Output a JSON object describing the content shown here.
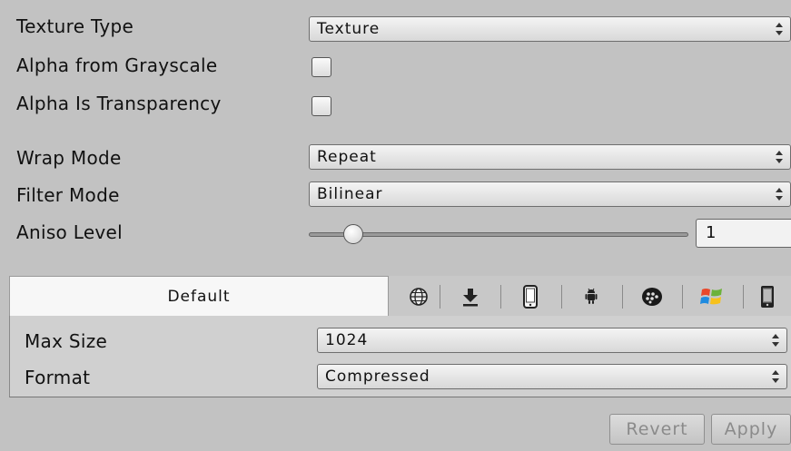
{
  "fields": {
    "texture_type": {
      "label": "Texture Type",
      "value": "Texture"
    },
    "alpha_from_grayscale": {
      "label": "Alpha from Grayscale",
      "checked": false
    },
    "alpha_is_transparency": {
      "label": "Alpha Is Transparency",
      "checked": false
    },
    "wrap_mode": {
      "label": "Wrap Mode",
      "value": "Repeat"
    },
    "filter_mode": {
      "label": "Filter Mode",
      "value": "Bilinear"
    },
    "aniso_level": {
      "label": "Aniso Level",
      "value": "1",
      "slider_fraction": 0.1
    }
  },
  "platform_tabs": {
    "default_label": "Default",
    "icons": [
      "globe-icon",
      "download-icon",
      "iphone-icon",
      "android-icon",
      "blackberry-icon",
      "windows-icon",
      "windows-phone-icon"
    ]
  },
  "platform_settings": {
    "max_size": {
      "label": "Max Size",
      "value": "1024"
    },
    "format": {
      "label": "Format",
      "value": "Compressed"
    }
  },
  "buttons": {
    "revert": "Revert",
    "apply": "Apply"
  }
}
